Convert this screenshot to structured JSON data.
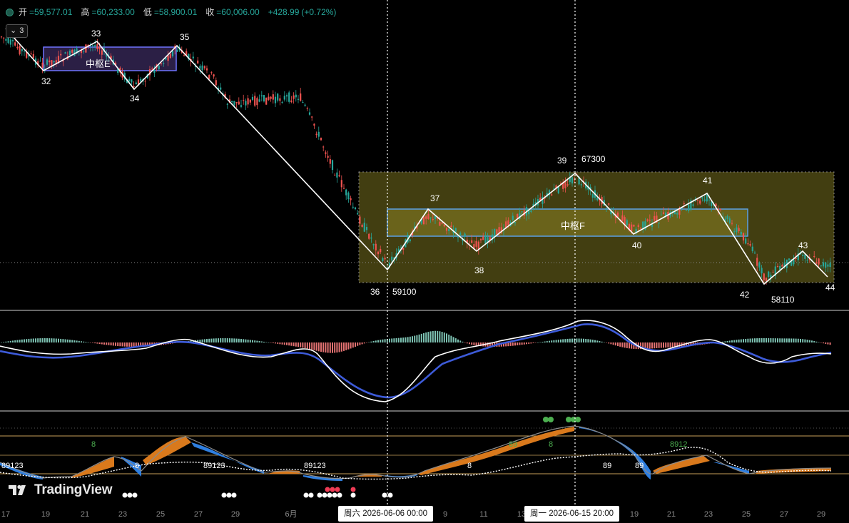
{
  "ohlc": {
    "open_label": "开",
    "open": "=59,577.01",
    "high_label": "高",
    "high": "=60,233.00",
    "low_label": "低",
    "low": "=58,900.01",
    "close_label": "收",
    "close": "=60,006.00",
    "change": "+428.99",
    "change_pct": "(+0.72%)"
  },
  "collapse_button": {
    "count": "3"
  },
  "pivot_labels": [
    "32",
    "33",
    "34",
    "35",
    "36",
    "37",
    "38",
    "39",
    "40",
    "41",
    "42",
    "43",
    "44"
  ],
  "price_labels": {
    "p39": "67300",
    "p36": "59100",
    "p42": "58110"
  },
  "zone_labels": {
    "e": "中枢E",
    "f": "中枢F"
  },
  "indicator_labels": {
    "green_8a": "8",
    "green_8b": "8",
    "green_89": "89",
    "green_8912": "8912",
    "white_8a": "8",
    "white_8b": "8",
    "white_89a": "89",
    "white_89b": "89",
    "white_89123a": "89123",
    "white_89123b": "89123",
    "white_89123c": "89123"
  },
  "x_axis_ticks": [
    "17",
    "19",
    "21",
    "23",
    "25",
    "27",
    "29",
    "6月",
    "9",
    "11",
    "13",
    "17",
    "19",
    "21",
    "23",
    "25",
    "27",
    "29"
  ],
  "crosshair": {
    "left": "周六 2026-06-06   00:00",
    "right": "周一 2026-06-15   20:00"
  },
  "brand": "TradingView",
  "colors": {
    "up": "#26a69a",
    "down": "#ef5350",
    "zone_e": "#3a2a5c",
    "zone_f": "#6b6420",
    "macd_blue": "#3d5bd9",
    "macd_white": "#ffffff",
    "fill_orange": "#d9791c",
    "fill_blue": "#2f7fe0"
  }
}
